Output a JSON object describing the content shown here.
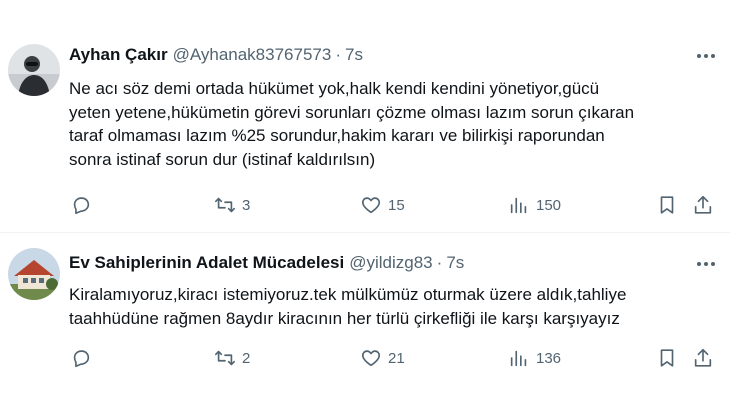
{
  "tweets": [
    {
      "author_name": "Ayhan Çakır",
      "handle": "@Ayhanak83767573",
      "separator": "·",
      "time": "7s",
      "text_lines": [
        "Ne acı söz demi ortada hükümet yok,halk kendi kendini yönetiyor,gücü",
        "yeten yetene,hükümetin görevi sorunları çözme olması lazım sorun çıkaran",
        "taraf olmaması lazım %25 sorundur,hakim kararı ve bilirkişi raporundan",
        "sonra istinaf sorun dur (istinaf kaldırılsın)"
      ],
      "replies": "",
      "retweets": "3",
      "likes": "15",
      "views": "150",
      "avatar_icon": "person-photo-avatar"
    },
    {
      "author_name": "Ev Sahiplerinin Adalet Mücadelesi",
      "handle": "@yildizg83",
      "separator": "·",
      "time": "7s",
      "text_lines": [
        "Kiralamıyoruz,kiracı istemiyoruz.tek mülkümüz oturmak üzere aldık,tahliye",
        "taahhüdüne rağmen 8aydır kiracının her türlü çirkefliği ile karşı karşıyayız"
      ],
      "replies": "",
      "retweets": "2",
      "likes": "21",
      "views": "136",
      "avatar_icon": "house-photo-avatar"
    }
  ],
  "icons": {
    "more": "more-icon",
    "reply": "reply-icon",
    "retweet": "retweet-icon",
    "like": "heart-icon",
    "views": "views-icon",
    "bookmark": "bookmark-icon",
    "share": "share-icon"
  },
  "colors": {
    "text": "#0f1419",
    "secondary": "#536471",
    "divider": "#eff3f4"
  }
}
